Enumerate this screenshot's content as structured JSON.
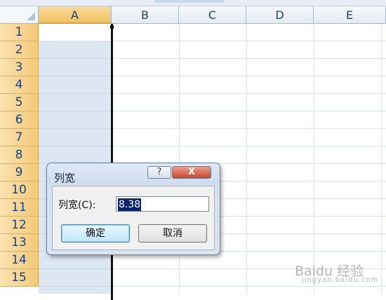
{
  "columns": [
    "A",
    "B",
    "C",
    "D",
    "E"
  ],
  "rows": [
    "1",
    "2",
    "3",
    "4",
    "5",
    "6",
    "7",
    "8",
    "9",
    "10",
    "11",
    "12",
    "13",
    "14",
    "15"
  ],
  "dialog": {
    "title": "列宽",
    "help_label": "?",
    "close_label": "X",
    "field_label": "列宽(C):",
    "field_value": "8.38",
    "ok_label": "确定",
    "cancel_label": "取消"
  },
  "watermark": {
    "text": "Baidu 经验",
    "sub": "jingyan.baidu.com"
  }
}
